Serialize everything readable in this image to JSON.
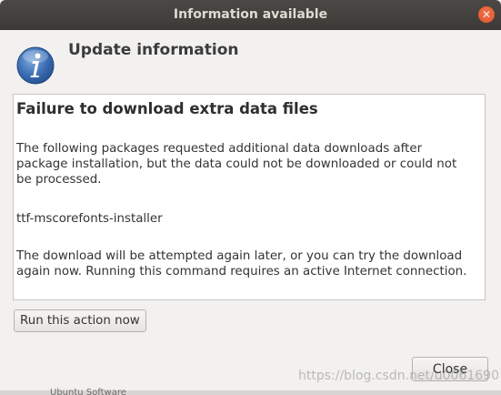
{
  "window": {
    "title": "Information available",
    "close_glyph": "✕"
  },
  "header": {
    "icon": "info-icon",
    "title": "Update information"
  },
  "panel": {
    "title": "Failure to download extra data files",
    "paragraph1": "The following packages requested additional data downloads after package installation, but the data could not be downloaded or could not be processed.",
    "package": "ttf-mscorefonts-installer",
    "paragraph2": "The download will be attempted again later, or you can try the download again now.  Running this command requires an active Internet connection."
  },
  "actions": {
    "run_label": "Run this action now",
    "close_label": "Close"
  },
  "watermark": "https://blog.csdn.net/u0061690",
  "bottom_partial_text": "Ubuntu Software",
  "colors": {
    "titlebar": "#3f3e3a",
    "close_button": "#e9592f",
    "info_icon": "#3b6db3",
    "panel_bg": "#ffffff",
    "window_bg": "#f2f1f0"
  }
}
